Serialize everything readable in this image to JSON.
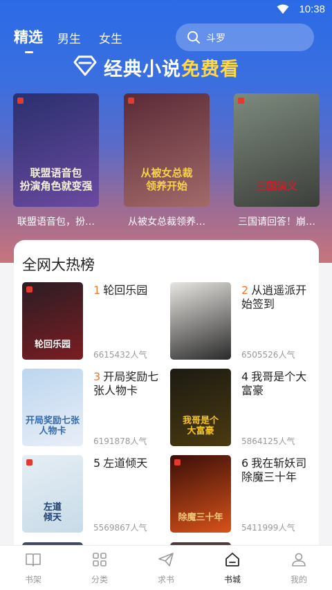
{
  "status_bar": {
    "time": "10:38"
  },
  "top_tabs": [
    {
      "label": "精选",
      "active": true
    },
    {
      "label": "男生",
      "active": false
    },
    {
      "label": "女生",
      "active": false
    }
  ],
  "search": {
    "placeholder": "斗罗"
  },
  "banner": {
    "title_prefix": "经典小说",
    "title_highlight": "免费看"
  },
  "featured_books": [
    {
      "name": "联盟语音包，扮…",
      "cover_title": "联盟语音包\n扮演角色就变强",
      "colors": [
        "#2a2f6e",
        "#6b4aa0"
      ],
      "title_color": "#f4f0d8"
    },
    {
      "name": "从被女总裁领养…",
      "cover_title": "从被女总裁\n领养开始",
      "colors": [
        "#5a2a36",
        "#a26a6a"
      ],
      "title_color": "#f7d24a"
    },
    {
      "name": "三国请回答！崩…",
      "cover_title": "三国演义",
      "colors": [
        "#7d8a7e",
        "#3c3f3a"
      ],
      "title_color": "#c8202a"
    }
  ],
  "ranking": {
    "title": "全网大热榜",
    "items": [
      {
        "rank": "1",
        "title": "轮回乐园",
        "popularity": "6615432人气",
        "hot": true,
        "cover_title": "轮回乐园",
        "colors": [
          "#2b1d24",
          "#7a1d22"
        ],
        "title_color": "#ffffff"
      },
      {
        "rank": "2",
        "title": "从逍遥派开始签到",
        "popularity": "6505526人气",
        "hot": true,
        "cover_title": "",
        "colors": [
          "#e8e6e2",
          "#2a2a2a"
        ],
        "title_color": "#333333"
      },
      {
        "rank": "3",
        "title": "开局奖励七张人物卡",
        "popularity": "6191878人气",
        "hot": true,
        "cover_title": "开局奖励七张人物卡",
        "colors": [
          "#bcd6ef",
          "#e9eef7"
        ],
        "title_color": "#3a6aa8"
      },
      {
        "rank": "4",
        "title": "我哥是个大富豪",
        "popularity": "5864125人气",
        "hot": false,
        "cover_title": "我哥是个\n大富豪",
        "colors": [
          "#1c1a12",
          "#4a3a10"
        ],
        "title_color": "#f4c21a"
      },
      {
        "rank": "5",
        "title": "左道倾天",
        "popularity": "5569867人气",
        "hot": false,
        "cover_title": "左道\n倾天",
        "colors": [
          "#e6eef4",
          "#c7dbe8"
        ],
        "title_color": "#1b3e6e"
      },
      {
        "rank": "6",
        "title": "我在斩妖司除魔三十年",
        "popularity": "5411999人气",
        "hot": false,
        "cover_title": "除魔三十年",
        "colors": [
          "#3a0e08",
          "#d8521a"
        ],
        "title_color": "#f0c87a"
      }
    ]
  },
  "bottom_nav": [
    {
      "label": "书架",
      "icon": "bookshelf-icon",
      "active": false
    },
    {
      "label": "分类",
      "icon": "category-grid-icon",
      "active": false
    },
    {
      "label": "求书",
      "icon": "paper-plane-icon",
      "active": false
    },
    {
      "label": "书城",
      "icon": "bookstore-home-icon",
      "active": true
    },
    {
      "label": "我的",
      "icon": "user-icon",
      "active": false
    }
  ]
}
